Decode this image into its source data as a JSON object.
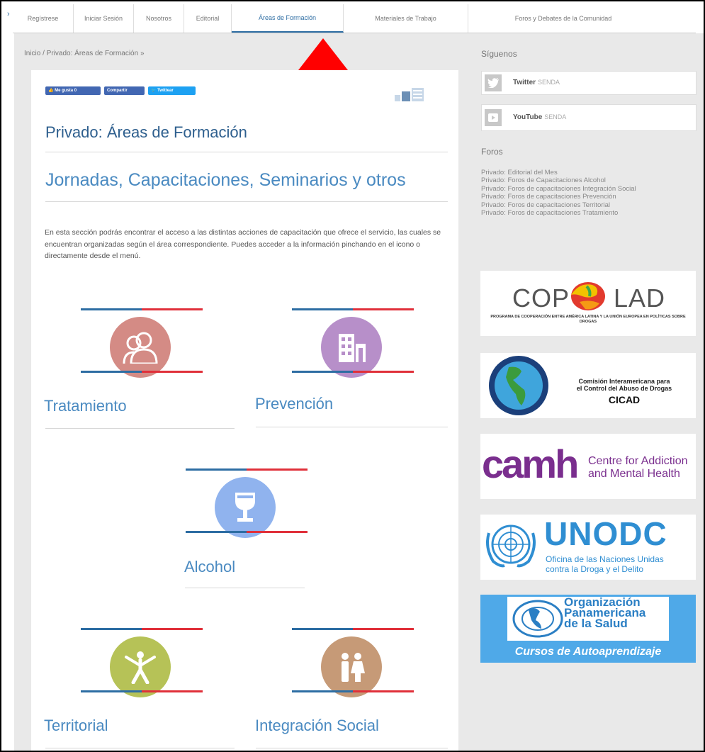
{
  "nav": {
    "edge_glyph": "›",
    "tabs": [
      "Regístrese",
      "Iniciar Sesión",
      "Nosotros",
      "Editorial",
      "Áreas de Formación",
      "Materiales de Trabajo",
      "Foros y Debates de la Comunidad"
    ]
  },
  "breadcrumb": "Inicio / Privado: Áreas de Formación »",
  "share": {
    "like": "Me gusta 0",
    "share": "Compartir",
    "tweet": "Twittear"
  },
  "page": {
    "title": "Privado: Áreas de Formación",
    "subtitle": "Jornadas, Capacitaciones, Seminarios y otros",
    "description": "En esta sección podrás encontrar el acceso a las distintas acciones de capacitación que ofrece el servicio, las cuales se encuentran organizadas según el área correspondiente. Puedes acceder a la información pinchando en el icono o directamente desde el menú."
  },
  "areas": [
    {
      "label": "Tratamiento",
      "icon": "people-icon",
      "color": "#d48b85"
    },
    {
      "label": "Prevención",
      "icon": "building-icon",
      "color": "#b78fc9"
    },
    {
      "label": "Alcohol",
      "icon": "wine-glass-icon",
      "color": "#90b3ee"
    },
    {
      "label": "Territorial",
      "icon": "person-icon",
      "color": "#b6c257"
    },
    {
      "label": "Integración Social",
      "icon": "family-icon",
      "color": "#c69a77"
    }
  ],
  "sidebar": {
    "siguenos": "Síguenos",
    "social": [
      {
        "name": "Twitter",
        "handle": "SENDA",
        "icon": "twitter-icon"
      },
      {
        "name": "YouTube",
        "handle": "SENDA",
        "icon": "youtube-icon"
      }
    ],
    "foros_title": "Foros",
    "foros": [
      "Privado: Editorial del Mes",
      "Privado: Foros de Capacitaciones Alcohol",
      "Privado: Foros de capacitaciones Integración Social",
      "Privado: Foros de capacitaciones Prevención",
      "Privado: Foros de capacitaciones Territorial",
      "Privado: Foros de capacitaciones Tratamiento"
    ],
    "logos": {
      "copolad": {
        "name": "COPOLAD",
        "left": "COP",
        "right": "LAD",
        "tagline": "PROGRAMA DE COOPERACIÓN ENTRE AMÉRICA LATINA Y LA UNIÓN EUROPEA EN POLÍTICAS SOBRE DROGAS"
      },
      "cicad": {
        "line1": "Comisión Interamericana para",
        "line2": "el Control del Abuso de Drogas",
        "acronym": "CICAD"
      },
      "camh": {
        "short": "camh",
        "line1": "Centre for Addiction",
        "line2": "and Mental Health"
      },
      "unodc": {
        "acronym": "UNODC",
        "line1": "Oficina de las Naciones Unidas",
        "line2": "contra la Droga y el Delito"
      },
      "ops": {
        "line1": "Organización",
        "line2": "Panamericana",
        "line3": "de la Salud",
        "footer": "Cursos de Autoaprendizaje"
      }
    }
  },
  "colors": {
    "accent": "#2d6da3",
    "red": "#e0303a",
    "ops_blue": "#4fa9e8"
  }
}
